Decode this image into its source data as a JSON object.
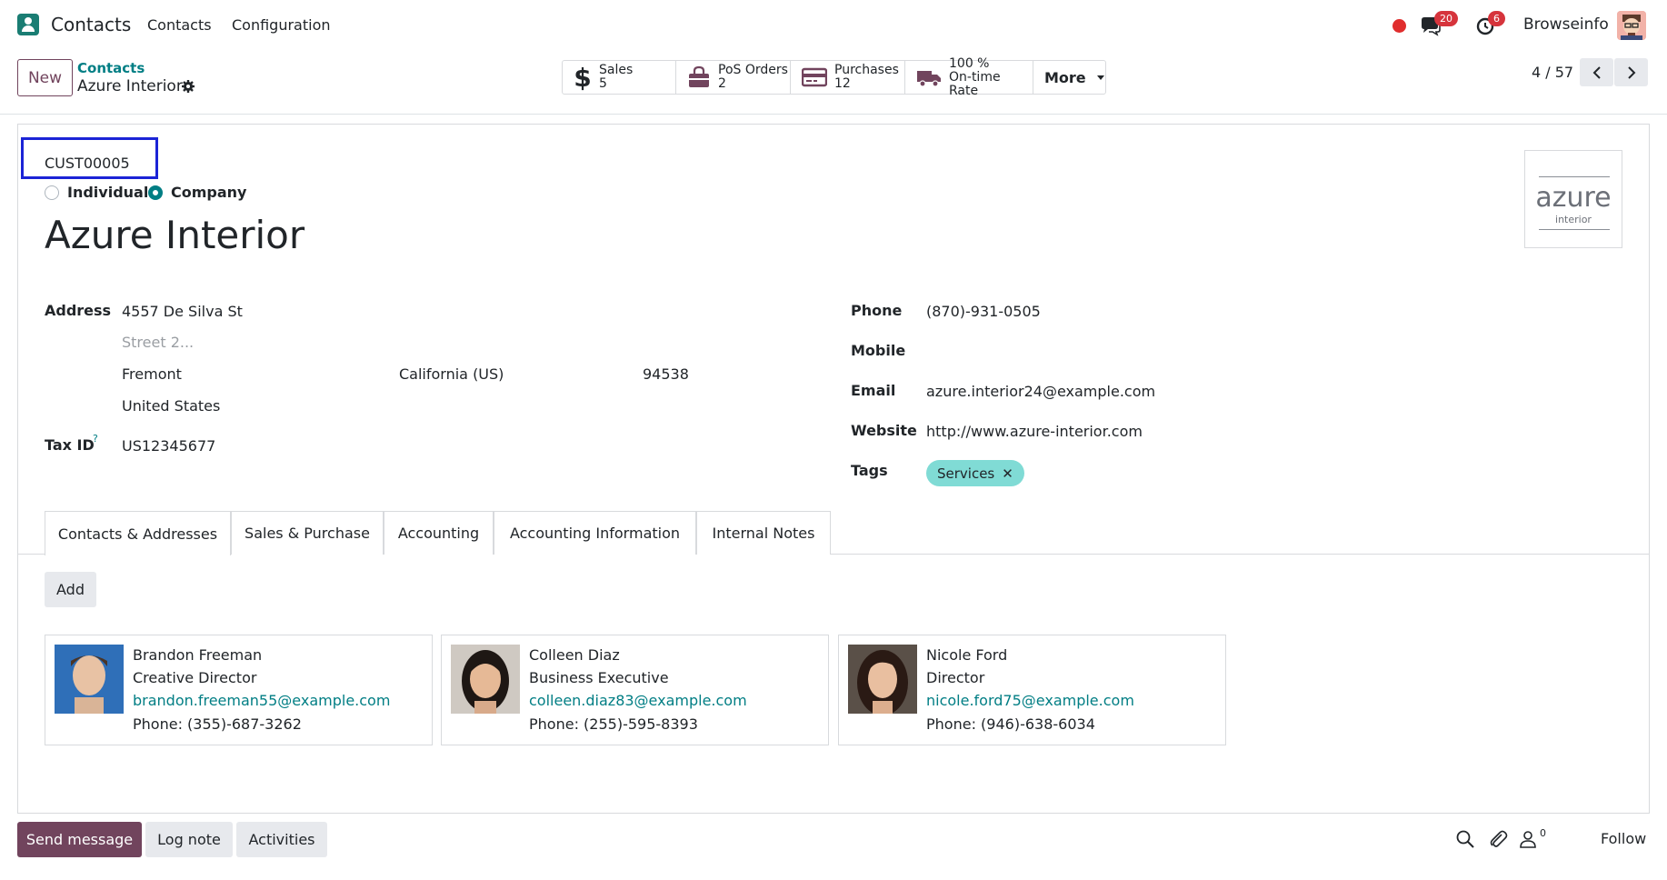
{
  "navbar": {
    "app_name": "Contacts",
    "menu": [
      "Contacts",
      "Configuration"
    ],
    "messages_badge": "20",
    "activities_badge": "6",
    "company": "Browseinfo"
  },
  "control_panel": {
    "new_label": "New",
    "breadcrumb_parent": "Contacts",
    "breadcrumb_current": "Azure Interior",
    "stats": [
      {
        "label": "Sales",
        "value": "5",
        "icon": "dollar-icon"
      },
      {
        "label": "PoS Orders",
        "value": "2",
        "icon": "shopping-bag-icon"
      },
      {
        "label": "Purchases",
        "value": "12",
        "icon": "credit-card-icon"
      },
      {
        "label": "On-time Rate",
        "value": "100 %",
        "icon": "truck-icon"
      }
    ],
    "more_label": "More",
    "pager": "4 / 57"
  },
  "form": {
    "reference": "CUST00005",
    "company_type_options": [
      "Individual",
      "Company"
    ],
    "company_type_selected": "Company",
    "name": "Azure Interior",
    "logo_text": "azure",
    "logo_subtext": "interior",
    "address_label": "Address",
    "street": "4557 De Silva St",
    "street2_placeholder": "Street 2...",
    "city": "Fremont",
    "state": "California (US)",
    "zip": "94538",
    "country": "United States",
    "tax_id_label": "Tax ID",
    "tax_id_help": "?",
    "tax_id": "US12345677",
    "phone_label": "Phone",
    "phone": "(870)-931-0505",
    "mobile_label": "Mobile",
    "mobile": "",
    "email_label": "Email",
    "email": "azure.interior24@example.com",
    "website_label": "Website",
    "website": "http://www.azure-interior.com",
    "tags_label": "Tags",
    "tags": [
      "Services"
    ]
  },
  "notebook": {
    "tabs": [
      "Contacts & Addresses",
      "Sales & Purchase",
      "Accounting",
      "Accounting Information",
      "Internal Notes"
    ],
    "active_tab": "Contacts & Addresses",
    "add_label": "Add",
    "contacts": [
      {
        "name": "Brandon Freeman",
        "title": "Creative Director",
        "email": "brandon.freeman55@example.com",
        "phone": "Phone: (355)-687-3262"
      },
      {
        "name": "Colleen Diaz",
        "title": "Business Executive",
        "email": "colleen.diaz83@example.com",
        "phone": "Phone: (255)-595-8393"
      },
      {
        "name": "Nicole Ford",
        "title": "Director",
        "email": "nicole.ford75@example.com",
        "phone": "Phone: (946)-638-6034"
      }
    ]
  },
  "chatter": {
    "send_message": "Send message",
    "log_note": "Log note",
    "activities": "Activities",
    "followers_count": "0",
    "follow": "Follow"
  },
  "colors": {
    "brand": "#71445d",
    "accent": "#017e84",
    "tag": "#80dbd5",
    "badge": "#d6343c",
    "highlight_box": "#1b24d6"
  }
}
